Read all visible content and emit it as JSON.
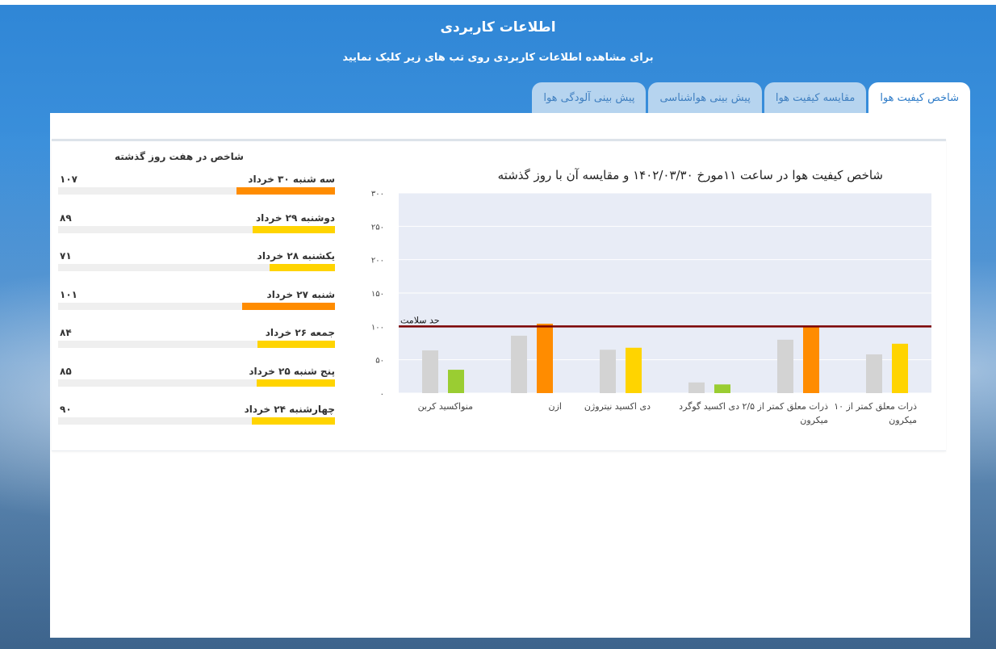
{
  "header": {
    "title": "اطلاعات کاربردی",
    "subtitle": "برای مشاهده اطلاعات کاربردی روی تب های زیر کلیک نمایید"
  },
  "tabs": [
    {
      "label": "شاخص کیفیت هوا",
      "active": true
    },
    {
      "label": "مقایسه کیفیت هوا",
      "active": false
    },
    {
      "label": "پیش بینی هواشناسی",
      "active": false
    },
    {
      "label": "پیش بینی آلودگی هوا",
      "active": false
    }
  ],
  "history": {
    "title": "شاخص در هفت روز گذشته",
    "days": [
      {
        "name": "سه شنبه ۳۰ خرداد",
        "value_label": "۱۰۷",
        "value": 107,
        "color": "#ff8c00"
      },
      {
        "name": "دوشنبه ۲۹ خرداد",
        "value_label": "۸۹",
        "value": 89,
        "color": "#ffd400"
      },
      {
        "name": "یکشنبه ۲۸ خرداد",
        "value_label": "۷۱",
        "value": 71,
        "color": "#ffd400"
      },
      {
        "name": "شنبه ۲۷ خرداد",
        "value_label": "۱۰۱",
        "value": 101,
        "color": "#ff8c00"
      },
      {
        "name": "جمعه ۲۶ خرداد",
        "value_label": "۸۴",
        "value": 84,
        "color": "#ffd400"
      },
      {
        "name": "پنج شنبه ۲۵ خرداد",
        "value_label": "۸۵",
        "value": 85,
        "color": "#ffd400"
      },
      {
        "name": "چهارشنبه ۲۴ خرداد",
        "value_label": "۹۰",
        "value": 90,
        "color": "#ffd400"
      }
    ],
    "scale_max": 300
  },
  "chart_data": {
    "type": "bar",
    "title": "شاخص کیفیت هوا در ساعت ۱۱مورخ ۱۴۰۲/۰۳/۳۰ و مقایسه آن با روز گذشته",
    "ylim": [
      0,
      300
    ],
    "yticks": [
      0,
      50,
      100,
      150,
      200,
      250,
      300
    ],
    "ytick_labels": [
      "۰",
      "۵۰",
      "۱۰۰",
      "۱۵۰",
      "۲۰۰",
      "۲۵۰",
      "۳۰۰"
    ],
    "categories": [
      [
        "ذرات معلق کمتر از ۱۰",
        "میکرون"
      ],
      [
        "ذرات معلق کمتر از ۲/۵",
        "میکرون"
      ],
      [
        "دی اکسید گوگرد"
      ],
      [
        "دی اکسید نیتروژن"
      ],
      [
        "ازن"
      ],
      [
        "منواکسید کربن"
      ]
    ],
    "series": [
      {
        "values": [
          58,
          80,
          16,
          65,
          86,
          64
        ],
        "color": "#d3d3d3"
      },
      {
        "values": [
          74,
          100,
          13,
          68,
          104,
          35
        ],
        "colors": [
          "#ffd400",
          "#ff8c00",
          "#9acd32",
          "#ffd400",
          "#ff8c00",
          "#9acd32"
        ]
      }
    ],
    "threshold": {
      "value": 100,
      "label": "حد سلامت",
      "color": "#7a0000"
    },
    "grid": true
  }
}
